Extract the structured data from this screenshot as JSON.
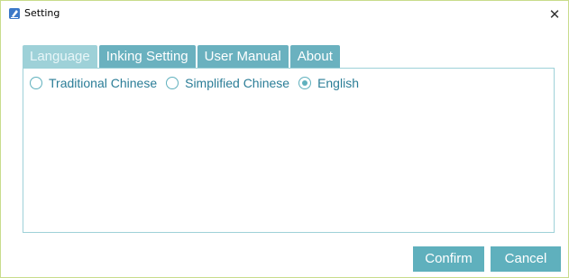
{
  "window": {
    "title": "Setting",
    "close_glyph": "✕"
  },
  "tabs": [
    {
      "label": "Language",
      "active": true
    },
    {
      "label": "Inking Setting",
      "active": false
    },
    {
      "label": "User Manual",
      "active": false
    },
    {
      "label": "About",
      "active": false
    }
  ],
  "language": {
    "options": [
      {
        "label": "Traditional Chinese",
        "checked": false
      },
      {
        "label": "Simplified Chinese",
        "checked": false
      },
      {
        "label": "English",
        "checked": true
      }
    ]
  },
  "buttons": {
    "confirm": "Confirm",
    "cancel": "Cancel"
  },
  "colors": {
    "accent": "#5fb0bd",
    "tab_inactive": "#6ab1bf",
    "tab_active": "#9ed1d8",
    "label_text": "#2b7d97"
  },
  "icons": {
    "app": "pen-icon",
    "close": "close-icon"
  }
}
